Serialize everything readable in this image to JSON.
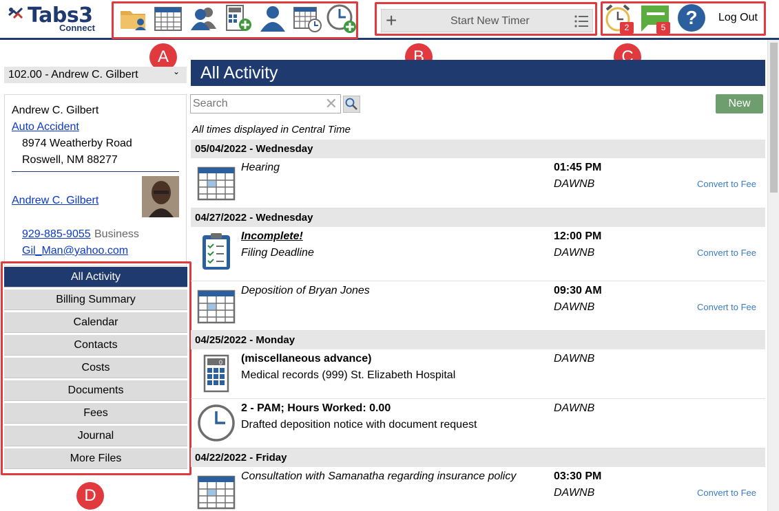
{
  "app": {
    "logo_text": "Tabs3",
    "logo_sub": "Connect"
  },
  "toolbar": {
    "icons": [
      "client-folder-icon",
      "calendar-icon",
      "contacts-icon",
      "add-cost-icon",
      "client-icon",
      "calendar-clock-icon",
      "add-timer-icon"
    ],
    "timer_label": "Start New Timer",
    "reminder_count": "2",
    "message_count": "5",
    "logout_label": "Log Out"
  },
  "callouts": {
    "a": "A",
    "b": "B",
    "c": "C",
    "d": "D"
  },
  "colors": {
    "navy": "#1e3a6e",
    "callout_red": "#e0393e",
    "new_button": "#6e9e6e",
    "link": "#0a39c7"
  },
  "sidebar": {
    "matter": "102.00 - Andrew C. Gilbert",
    "client": {
      "name": "Andrew C. Gilbert",
      "matter_link": "Auto Accident",
      "address1": "8974 Weatherby Road",
      "address2": "Roswell, NM 88277",
      "contact_link": "Andrew C. Gilbert",
      "phone": "929-885-9055",
      "phone_type": "Business",
      "email": "Gil_Man@yahoo.com"
    },
    "nav": [
      {
        "label": "All Activity",
        "active": true
      },
      {
        "label": "Billing Summary"
      },
      {
        "label": "Calendar"
      },
      {
        "label": "Contacts"
      },
      {
        "label": "Costs"
      },
      {
        "label": "Documents"
      },
      {
        "label": "Fees"
      },
      {
        "label": "Journal"
      },
      {
        "label": "More Files"
      }
    ]
  },
  "main": {
    "title": "All Activity",
    "search_placeholder": "Search",
    "new_label": "New",
    "tz_note": "All times displayed in Central Time",
    "convert_label": "Convert to Fee",
    "groups": [
      {
        "date": "05/04/2022 - Wednesday",
        "entries": [
          {
            "icon": "calendar-icon",
            "title": "Hearing",
            "time": "01:45 PM",
            "who": "DAWNB"
          }
        ]
      },
      {
        "date": "04/27/2022 - Wednesday",
        "entries": [
          {
            "icon": "task-clipboard-icon",
            "status": "Incomplete!",
            "title": "Filing Deadline",
            "time": "12:00 PM",
            "who": "DAWNB"
          },
          {
            "icon": "calendar-icon",
            "title": "Deposition of Bryan Jones",
            "time": "09:30 AM",
            "who": "DAWNB"
          }
        ]
      },
      {
        "date": "04/25/2022 - Monday",
        "entries": [
          {
            "icon": "cost-calculator-icon",
            "title": "(miscellaneous advance)",
            "description": "Medical records (999) St. Elizabeth Hospital",
            "who": "DAWNB"
          },
          {
            "icon": "fee-clock-icon",
            "title": "2 - PAM;  Hours Worked:  0.00",
            "description": "Drafted deposition notice with document request",
            "who": "DAWNB"
          }
        ]
      },
      {
        "date": "04/22/2022 - Friday",
        "entries": [
          {
            "icon": "calendar-icon",
            "title": "Consultation with Samanatha regarding insurance policy",
            "time": "03:30 PM",
            "who": "DAWNB"
          }
        ]
      }
    ]
  }
}
